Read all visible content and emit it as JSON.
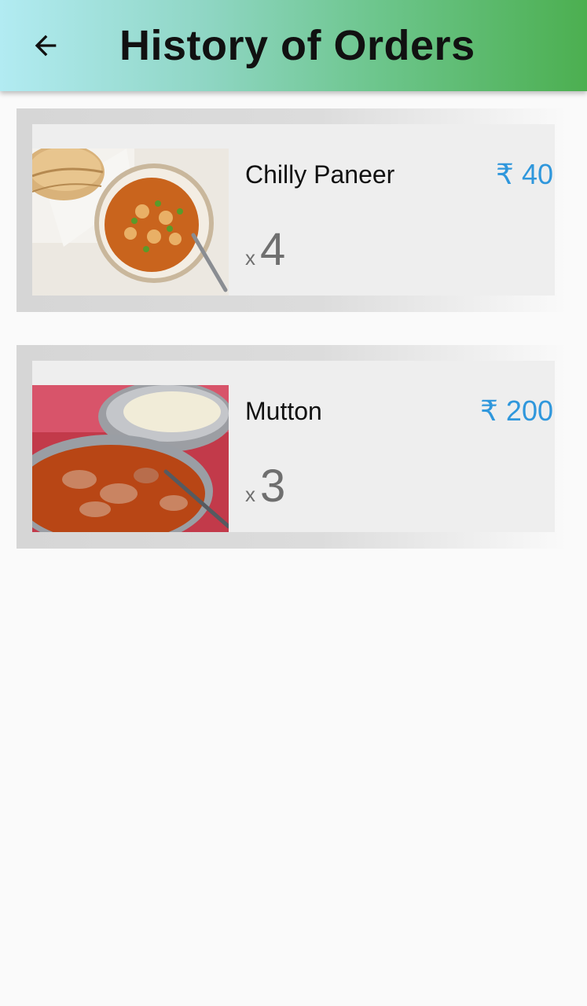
{
  "appbar": {
    "title": "History of Orders",
    "back_icon": "arrow-left-icon"
  },
  "colors": {
    "price": "#2f97dc",
    "appbar_gradient_start": "#b2ebf2",
    "appbar_gradient_end": "#4caf50"
  },
  "orders": [
    {
      "name": "Chilly Paneer",
      "price": "₹ 40",
      "qty_prefix": "x",
      "quantity": "4",
      "image": "paneer-curry-with-roti-photo"
    },
    {
      "name": "Mutton",
      "price": "₹ 200",
      "qty_prefix": "x",
      "quantity": "3",
      "image": "mutton-curry-with-naan-photo"
    }
  ]
}
